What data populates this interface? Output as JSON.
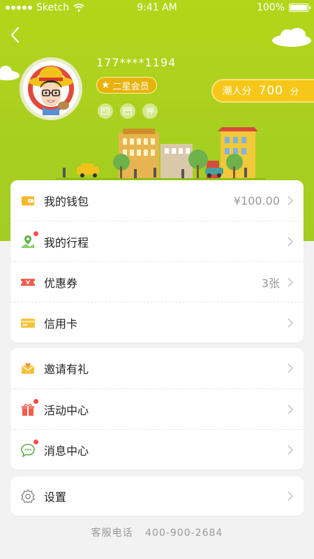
{
  "status_bar": {
    "carrier": "Sketch",
    "time": "9:41 AM",
    "battery": "100%"
  },
  "profile": {
    "phone": "177****1194",
    "level_label": "二星会员"
  },
  "mini_icons": [
    "id-card-icon",
    "card-icon",
    "deposit-icon"
  ],
  "mini_icon_texts": {
    "deposit": "押"
  },
  "points": {
    "label": "潮人分",
    "value": "700",
    "unit": "分"
  },
  "menu_group_1": [
    {
      "label": "我的钱包",
      "value": "¥100.00",
      "icon": "wallet-icon"
    },
    {
      "label": "我的行程",
      "value": "",
      "icon": "map-pin-icon",
      "badge": true
    },
    {
      "label": "优惠券",
      "value": "3张",
      "icon": "ticket-icon"
    },
    {
      "label": "信用卡",
      "value": "",
      "icon": "credit-card-icon"
    }
  ],
  "menu_group_2": [
    {
      "label": "邀请有礼",
      "value": "",
      "icon": "envelope-heart-icon"
    },
    {
      "label": "活动中心",
      "value": "",
      "icon": "gift-icon",
      "badge": true
    },
    {
      "label": "消息中心",
      "value": "",
      "icon": "chat-bubble-icon",
      "badge": true
    }
  ],
  "menu_group_3": [
    {
      "label": "设置",
      "value": "",
      "icon": "gear-icon"
    }
  ],
  "footer": {
    "label": "客服电话",
    "phone": "400-900-2684"
  },
  "colors": {
    "header_green": "#b5d51a",
    "gold": "#f6c718",
    "badge_red": "#ff4b4b"
  }
}
